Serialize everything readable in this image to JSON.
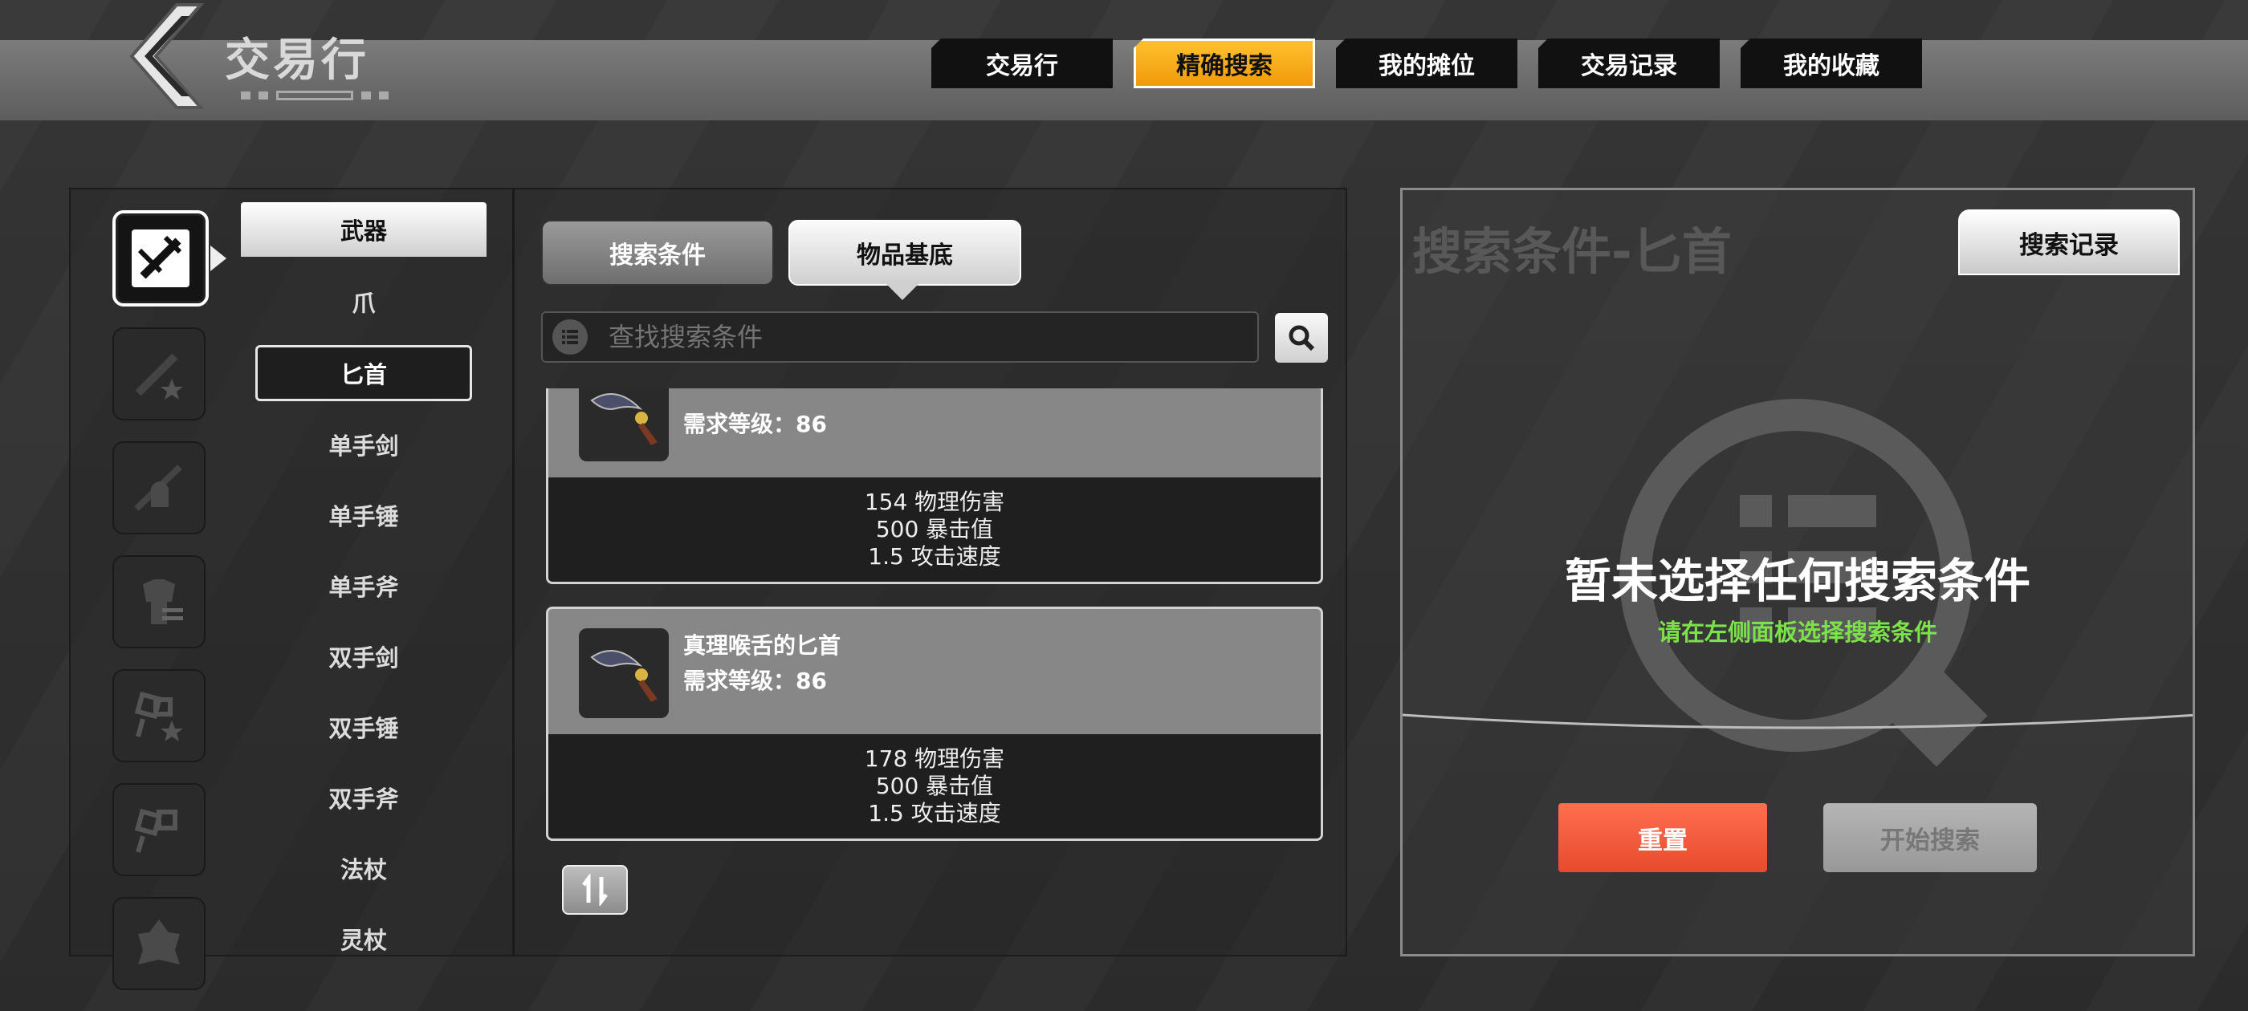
{
  "header": {
    "title": "交易行",
    "tabs": [
      {
        "label": "交易行",
        "active": false
      },
      {
        "label": "精确搜索",
        "active": true
      },
      {
        "label": "我的摊位",
        "active": false
      },
      {
        "label": "交易记录",
        "active": false
      },
      {
        "label": "我的收藏",
        "active": false
      }
    ]
  },
  "categories": {
    "icons": [
      "weapon-icon",
      "weapon-star-icon",
      "helmet-icon",
      "armor-icon",
      "accessory-star-icon",
      "accessory-icon",
      "relic-icon"
    ],
    "group_label": "武器",
    "items": [
      "爪",
      "匕首",
      "单手剑",
      "单手锤",
      "单手斧",
      "双手剑",
      "双手锤",
      "双手斧",
      "法杖",
      "灵杖"
    ],
    "selected": "匕首"
  },
  "filters": {
    "tab_conditions": "搜索条件",
    "tab_base": "物品基底",
    "search_placeholder": "查找搜索条件"
  },
  "results": [
    {
      "name": "",
      "requirement": "需求等级：86",
      "stats": [
        "154 物理伤害",
        "500 暴击值",
        "1.5 攻击速度"
      ]
    },
    {
      "name": "真理喉舌的匕首",
      "requirement": "需求等级：86",
      "stats": [
        "178 物理伤害",
        "500 暴击值",
        "1.5 攻击速度"
      ]
    }
  ],
  "right_panel": {
    "title": "搜索条件-匕首",
    "history_button": "搜索记录",
    "empty_title": "暂未选择任何搜索条件",
    "empty_hint": "请在左侧面板选择搜索条件",
    "reset_button": "重置",
    "start_button": "开始搜索"
  },
  "colors": {
    "accent": "#f5a414",
    "reset": "#f25a3a",
    "hint": "#7be24a"
  }
}
